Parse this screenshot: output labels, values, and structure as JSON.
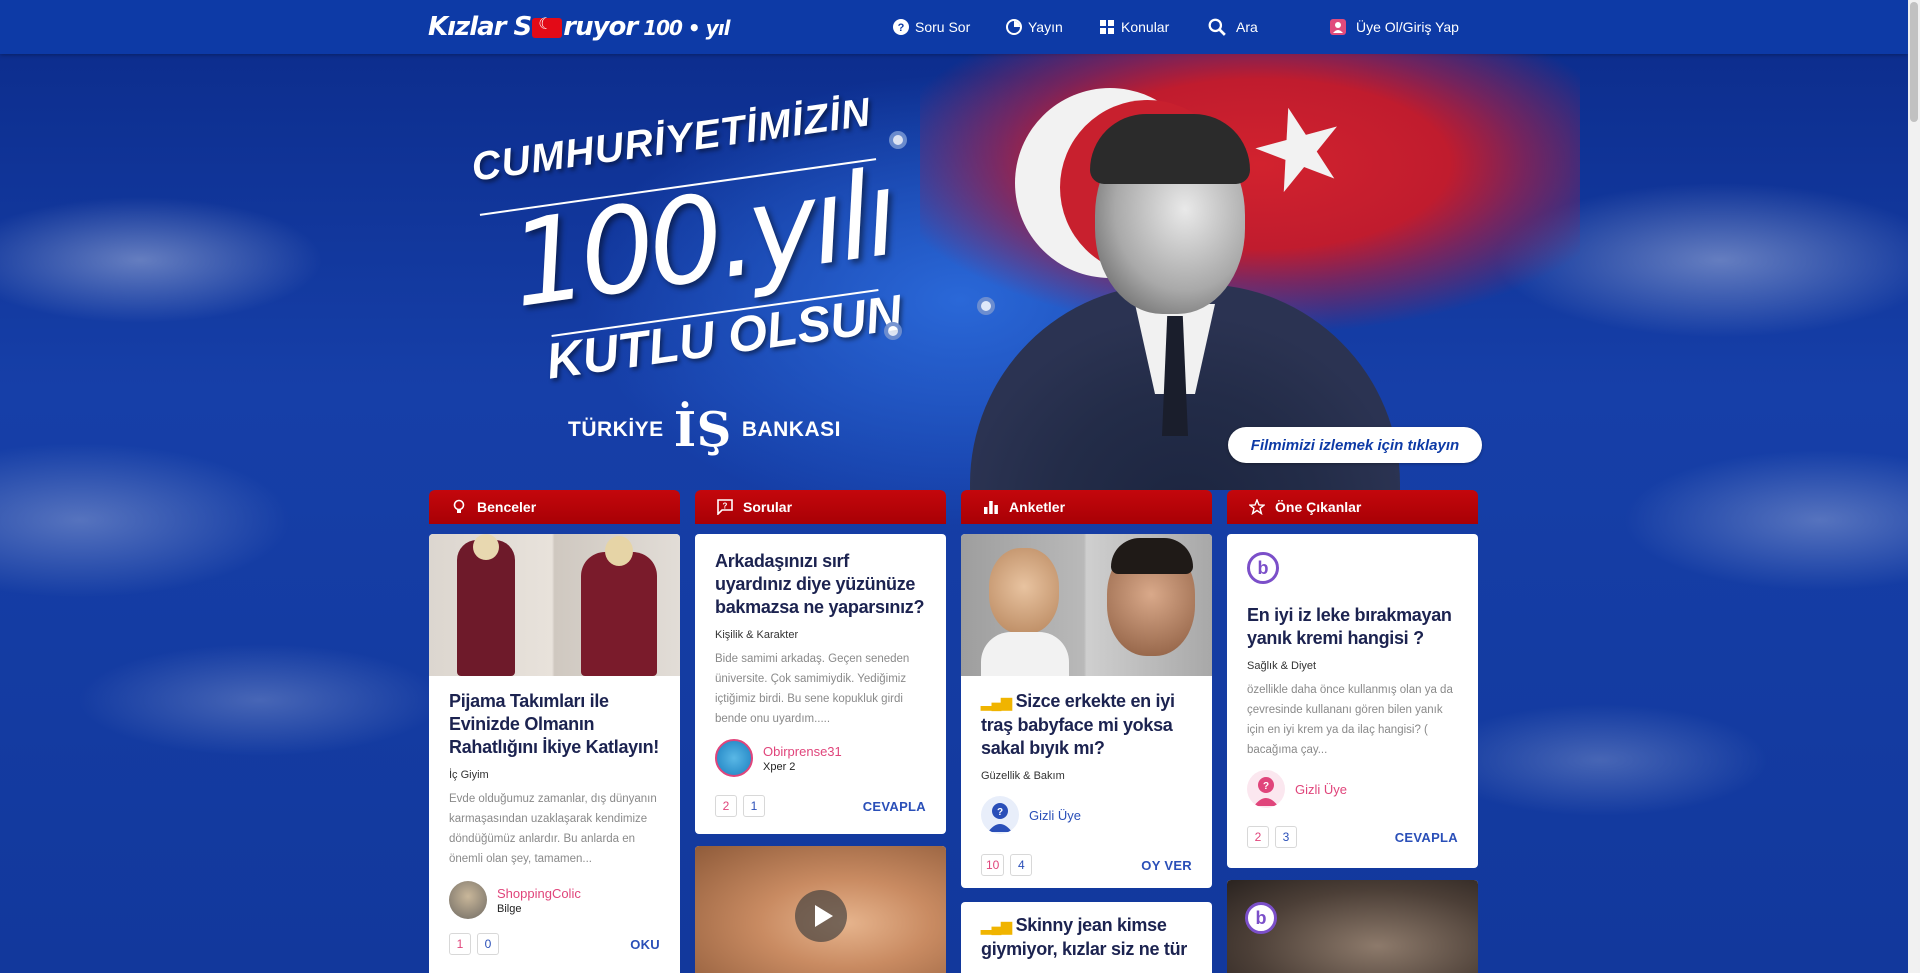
{
  "header": {
    "logo_text_a": "Kızlar S",
    "logo_text_b": "ruyor",
    "logo_hundred": "100 • yıl",
    "nav": {
      "ask": "Soru Sor",
      "publish": "Yayın",
      "topics": "Konular",
      "search": "Ara",
      "login": "Üye Ol/Giriş Yap"
    }
  },
  "hero": {
    "line1": "CUMHURİYETİMİZİN",
    "year": "100.yılı",
    "line2": "KUTLU OLSUN",
    "bank": "TÜRKİYE",
    "bank_mark": "İŞ",
    "bank2": "BANKASI",
    "film_button": "Filmimizi izlemek için tıklayın"
  },
  "columns": [
    {
      "header": "Benceler",
      "cards": [
        {
          "title": "Pijama Takımları ile Evinizde Olmanın Rahatlığını İkiye Katlayın!",
          "category": "İç Giyim",
          "desc": "Evde olduğumuz zamanlar, dış dünyanın karmaşasından uzaklaşarak kendimize döndüğümüz anlardır. Bu anlarda en önemli olan şey, tamamen...",
          "author": "ShoppingColic",
          "level": "Bilge",
          "count1": "1",
          "count2": "0",
          "action": "OKU"
        }
      ]
    },
    {
      "header": "Sorular",
      "cards": [
        {
          "title": "Arkadaşınızı sırf uyardınız diye yüzünüze bakmazsa ne yaparsınız?",
          "category": "Kişilik & Karakter",
          "desc": "Bide samimi arkadaş. Geçen seneden üniversite. Çok samimiydik. Yediğimiz içtiğimiz birdi. Bu sene kopukluk girdi bende onu uyardım.....",
          "author": "Obirprense31",
          "level": "Xper 2",
          "count1": "2",
          "count2": "1",
          "action": "CEVAPLA"
        }
      ]
    },
    {
      "header": "Anketler",
      "cards": [
        {
          "title": "Sizce erkekte en iyi traş babyface mi yoksa sakal bıyık mı?",
          "category": "Güzellik & Bakım",
          "author": "Gizli Üye",
          "count1": "10",
          "count2": "4",
          "action": "OY VER"
        },
        {
          "title": "Skinny jean kimse giymiyor, kızlar siz ne tür"
        }
      ]
    },
    {
      "header": "Öne Çıkanlar",
      "cards": [
        {
          "brand": "b",
          "title": "En iyi iz leke bırakmayan yanık kremi hangisi ?",
          "category": "Sağlık & Diyet",
          "desc": "özellikle daha önce kullanmış olan ya da çevresinde kullananı gören bilen yanık için en iyi krem ya da ilaç hangisi? ( bacağıma çay...",
          "author": "Gizli Üye",
          "count1": "2",
          "count2": "3",
          "action": "CEVAPLA"
        },
        {
          "brand": "b"
        }
      ]
    }
  ]
}
